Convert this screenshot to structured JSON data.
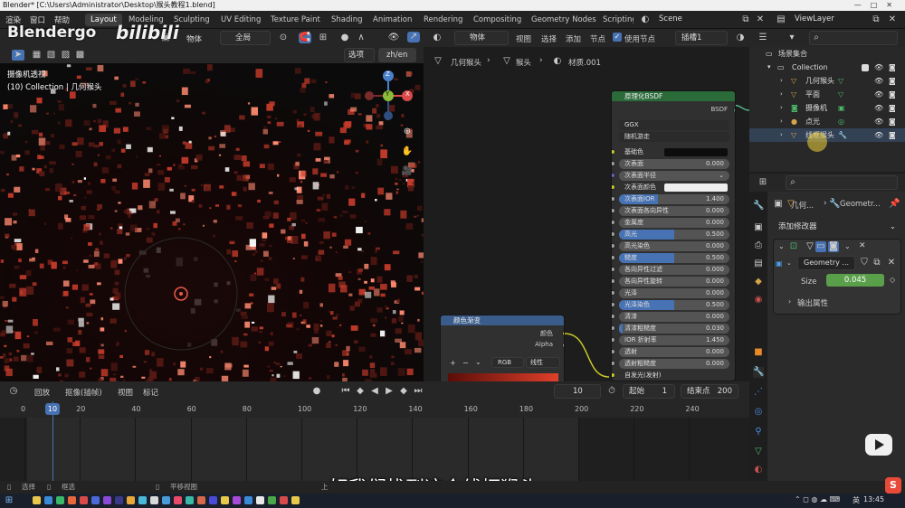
{
  "window": {
    "title": "Blender* [C:\\Users\\Administrator\\Desktop\\猴头教程1.blend]"
  },
  "menu": [
    "渲染",
    "窗口",
    "帮助"
  ],
  "workspaces": [
    "Layout",
    "Modeling",
    "Sculpting",
    "UV Editing",
    "Texture Paint",
    "Shading",
    "Animation",
    "Rendering",
    "Compositing",
    "Geometry Nodes",
    "Scripting"
  ],
  "active_workspace": "Layout",
  "scene": {
    "label": "Scene",
    "viewlayer": "ViewLayer"
  },
  "watermark": {
    "left": "Blendergo",
    "right": "bilibili"
  },
  "viewport": {
    "menu_object": "物体",
    "transform_orientation": "全局",
    "options": "选项",
    "lang_button": "zh/en",
    "info_line1": "摄像机透视",
    "info_line2": "(10) Collection | 几何猴头",
    "gizmo": {
      "z": "Z",
      "y": "Y",
      "x": "X"
    }
  },
  "node_editor": {
    "mode": "物体",
    "menus": [
      "视图",
      "选择",
      "添加",
      "节点"
    ],
    "use_nodes_label": "使用节点",
    "material_slot": "插槽1",
    "breadcrumb": [
      "几何猴头",
      "猴头",
      "材质.001"
    ],
    "bsdf": {
      "title": "原理化BSDF",
      "output": "BSDF",
      "distribution": "GGX",
      "subsurface_method": "随机游走",
      "rows": [
        {
          "label": "基础色",
          "value": "",
          "type": "color",
          "color": "#0d0d0d"
        },
        {
          "label": "次表面",
          "value": "0.000",
          "type": "num",
          "fill": 0
        },
        {
          "label": "次表面半径",
          "value": "",
          "type": "menu"
        },
        {
          "label": "次表面颜色",
          "value": "",
          "type": "color",
          "color": "#eeeeee"
        },
        {
          "label": "次表面IOR",
          "value": "1.400",
          "type": "num",
          "fill": 0.35
        },
        {
          "label": "次表面各向异性",
          "value": "0.000",
          "type": "num",
          "fill": 0
        },
        {
          "label": "金属度",
          "value": "0.000",
          "type": "num",
          "fill": 0
        },
        {
          "label": "高光",
          "value": "0.500",
          "type": "num",
          "fill": 0.5
        },
        {
          "label": "高光染色",
          "value": "0.000",
          "type": "num",
          "fill": 0
        },
        {
          "label": "糙度",
          "value": "0.500",
          "type": "num",
          "fill": 0.5
        },
        {
          "label": "各向异性过滤",
          "value": "0.000",
          "type": "num",
          "fill": 0
        },
        {
          "label": "各向异性旋转",
          "value": "0.000",
          "type": "num",
          "fill": 0
        },
        {
          "label": "光泽",
          "value": "0.000",
          "type": "num",
          "fill": 0
        },
        {
          "label": "光泽染色",
          "value": "0.500",
          "type": "num",
          "fill": 0.5
        },
        {
          "label": "清漆",
          "value": "0.000",
          "type": "num",
          "fill": 0
        },
        {
          "label": "清漆粗糙度",
          "value": "0.030",
          "type": "num",
          "fill": 0.03
        },
        {
          "label": "IOR 折射率",
          "value": "1.450",
          "type": "num",
          "fill": 0
        },
        {
          "label": "透射",
          "value": "0.000",
          "type": "num",
          "fill": 0
        },
        {
          "label": "透射粗糙度",
          "value": "0.000",
          "type": "num",
          "fill": 0
        },
        {
          "label": "自发光(发射)",
          "value": "",
          "type": "plain"
        }
      ]
    },
    "ramp": {
      "title": "颜色渐变",
      "out_color": "颜色",
      "out_alpha": "Alpha",
      "mode": "RGB",
      "interp": "线性"
    }
  },
  "outliner": {
    "rows": [
      {
        "label": "场景集合",
        "indent": 0
      },
      {
        "label": "Collection",
        "indent": 1
      },
      {
        "label": "几何猴头",
        "indent": 2
      },
      {
        "label": "平面",
        "indent": 2
      },
      {
        "label": "摄像机",
        "indent": 2
      },
      {
        "label": "点光",
        "indent": 2
      },
      {
        "label": "线框猴头",
        "indent": 2
      }
    ]
  },
  "properties": {
    "breadcrumb_obj": "几何...",
    "breadcrumb_mod": "Geometr...",
    "add_modifier": "添加修改器",
    "modifier_name": "Geometry ...",
    "size_label": "Size",
    "size_value": "0.045",
    "output_attrs": "输出属性"
  },
  "timeline": {
    "menus": [
      "回放",
      "抠像(插帧)",
      "视图",
      "标记"
    ],
    "current_frame": "10",
    "start_label": "起始",
    "start_value": "1",
    "end_label": "结束点",
    "end_value": "200",
    "ticks": [
      "0",
      "10",
      "20",
      "40",
      "60",
      "80",
      "100",
      "120",
      "140",
      "160",
      "180",
      "200",
      "220",
      "240"
    ]
  },
  "status": {
    "select": "选择",
    "box_select": "框选",
    "pan": "平移视图",
    "up": "上"
  },
  "subtitle": "好我们找到这个线框猴头",
  "taskbar": {
    "time": "13:45",
    "ime": "英"
  }
}
